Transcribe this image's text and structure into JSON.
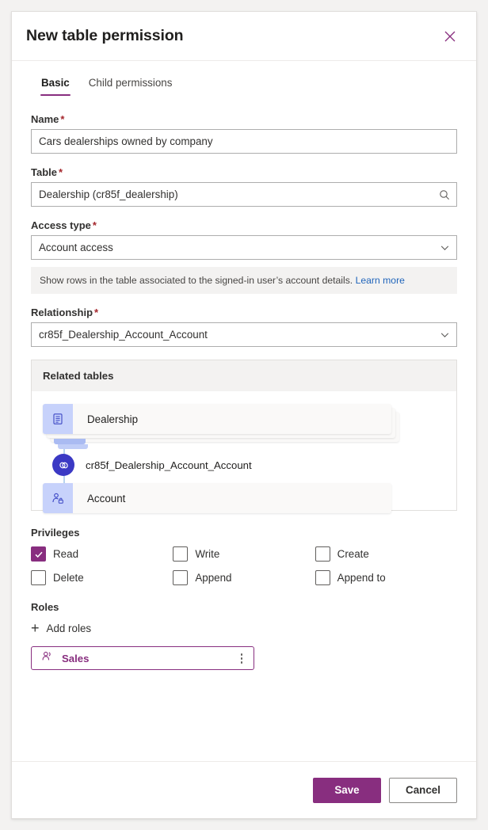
{
  "header": {
    "title": "New table permission",
    "close_icon": "close-icon"
  },
  "tabs": [
    {
      "label": "Basic",
      "active": true
    },
    {
      "label": "Child permissions",
      "active": false
    }
  ],
  "fields": {
    "name": {
      "label": "Name",
      "required": "*",
      "value": "Cars dealerships owned by company",
      "placeholder": ""
    },
    "table": {
      "label": "Table",
      "required": "*",
      "value": "Dealership (cr85f_dealership)",
      "placeholder": "",
      "icon": "search-icon"
    },
    "access_type": {
      "label": "Access type",
      "required": "*",
      "value": "Account access",
      "icon": "chevron-down-icon",
      "hint_text": "Show rows in the table associated to the signed-in user’s account details.",
      "hint_link": "Learn more"
    },
    "relationship": {
      "label": "Relationship",
      "required": "*",
      "value": "cr85f_Dealership_Account_Account",
      "icon": "chevron-down-icon"
    }
  },
  "related_tables": {
    "heading": "Related tables",
    "source_table": "Dealership",
    "relationship_name": "cr85f_Dealership_Account_Account",
    "target_table": "Account"
  },
  "privileges": {
    "label": "Privileges",
    "items": [
      {
        "label": "Read",
        "checked": true
      },
      {
        "label": "Write",
        "checked": false
      },
      {
        "label": "Create",
        "checked": false
      },
      {
        "label": "Delete",
        "checked": false
      },
      {
        "label": "Append",
        "checked": false
      },
      {
        "label": "Append to",
        "checked": false
      }
    ]
  },
  "roles": {
    "label": "Roles",
    "add_label": "Add roles",
    "items": [
      {
        "name": "Sales"
      }
    ]
  },
  "footer": {
    "save_label": "Save",
    "cancel_label": "Cancel"
  },
  "colors": {
    "accent_purple": "#882e7f",
    "link_blue": "#2266bb",
    "required_red": "#a4262c",
    "node_icon_bg": "#c7d2fb",
    "rel_badge_bg": "#3b39c4"
  }
}
